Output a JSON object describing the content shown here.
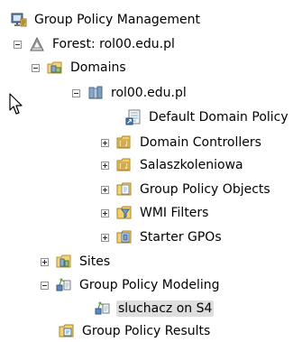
{
  "tree": {
    "root_label": "Group Policy Management",
    "forest_label": "Forest: rol00.edu.pl",
    "domains_label": "Domains",
    "domain_label": "rol00.edu.pl",
    "default_domain_policy_label": "Default Domain Policy",
    "domain_controllers_label": "Domain Controllers",
    "salaszkoleniowa_label": "Salaszkoleniowa",
    "gpo_label": "Group Policy Objects",
    "wmi_label": "WMI Filters",
    "starter_gpos_label": "Starter GPOs",
    "sites_label": "Sites",
    "modeling_label": "Group Policy Modeling",
    "modeling_item_label": "sluchacz on S4",
    "results_label": "Group Policy Results"
  }
}
